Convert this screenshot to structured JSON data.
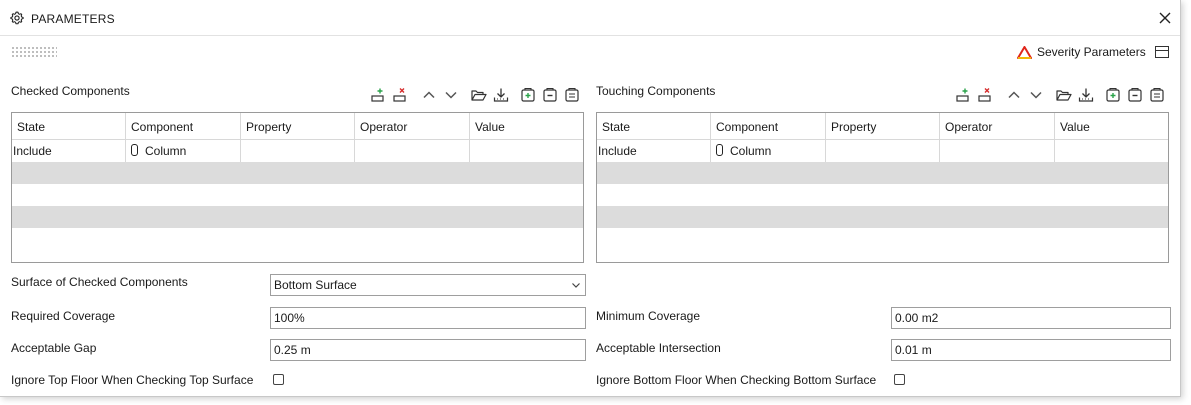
{
  "window": {
    "title": "PARAMETERS",
    "title_icon": "gear-icon",
    "close_icon": "close-icon"
  },
  "header": {
    "severity_label": "Severity Parameters",
    "severity_icon": "severity-triangle-icon",
    "panel_icon": "panel-layout-icon"
  },
  "checked": {
    "title": "Checked Components",
    "columns": [
      "State",
      "Component",
      "Property",
      "Operator",
      "Value"
    ],
    "rows": [
      {
        "state": "Include",
        "component": "Column",
        "property": "",
        "operator": "",
        "value": ""
      }
    ]
  },
  "touching": {
    "title": "Touching Components",
    "columns": [
      "State",
      "Component",
      "Property",
      "Operator",
      "Value"
    ],
    "rows": [
      {
        "state": "Include",
        "component": "Column",
        "property": "",
        "operator": "",
        "value": ""
      }
    ]
  },
  "toolbar_icons": [
    "add-row-icon",
    "remove-row-icon",
    "move-up-icon",
    "move-down-icon",
    "open-folder-icon",
    "download-icon",
    "add-group-icon",
    "remove-group-icon",
    "group-list-icon"
  ],
  "form": {
    "surface_label": "Surface of Checked Components",
    "surface_value": "Bottom Surface",
    "required_coverage_label": "Required Coverage",
    "required_coverage_value": "100%",
    "acceptable_gap_label": "Acceptable Gap",
    "acceptable_gap_value": "0.25 m",
    "ignore_top_label": "Ignore Top Floor When Checking Top Surface",
    "ignore_top_checked": false,
    "minimum_coverage_label": "Minimum Coverage",
    "minimum_coverage_value": "0.00 m2",
    "acceptable_intersection_label": "Acceptable Intersection",
    "acceptable_intersection_value": "0.01 m",
    "ignore_bottom_label": "Ignore Bottom Floor When Checking Bottom Surface",
    "ignore_bottom_checked": false
  },
  "colors": {
    "add": "#2aa34a",
    "remove": "#d62c2c",
    "severity_red": "#e0261b",
    "severity_yellow": "#f2b705"
  }
}
